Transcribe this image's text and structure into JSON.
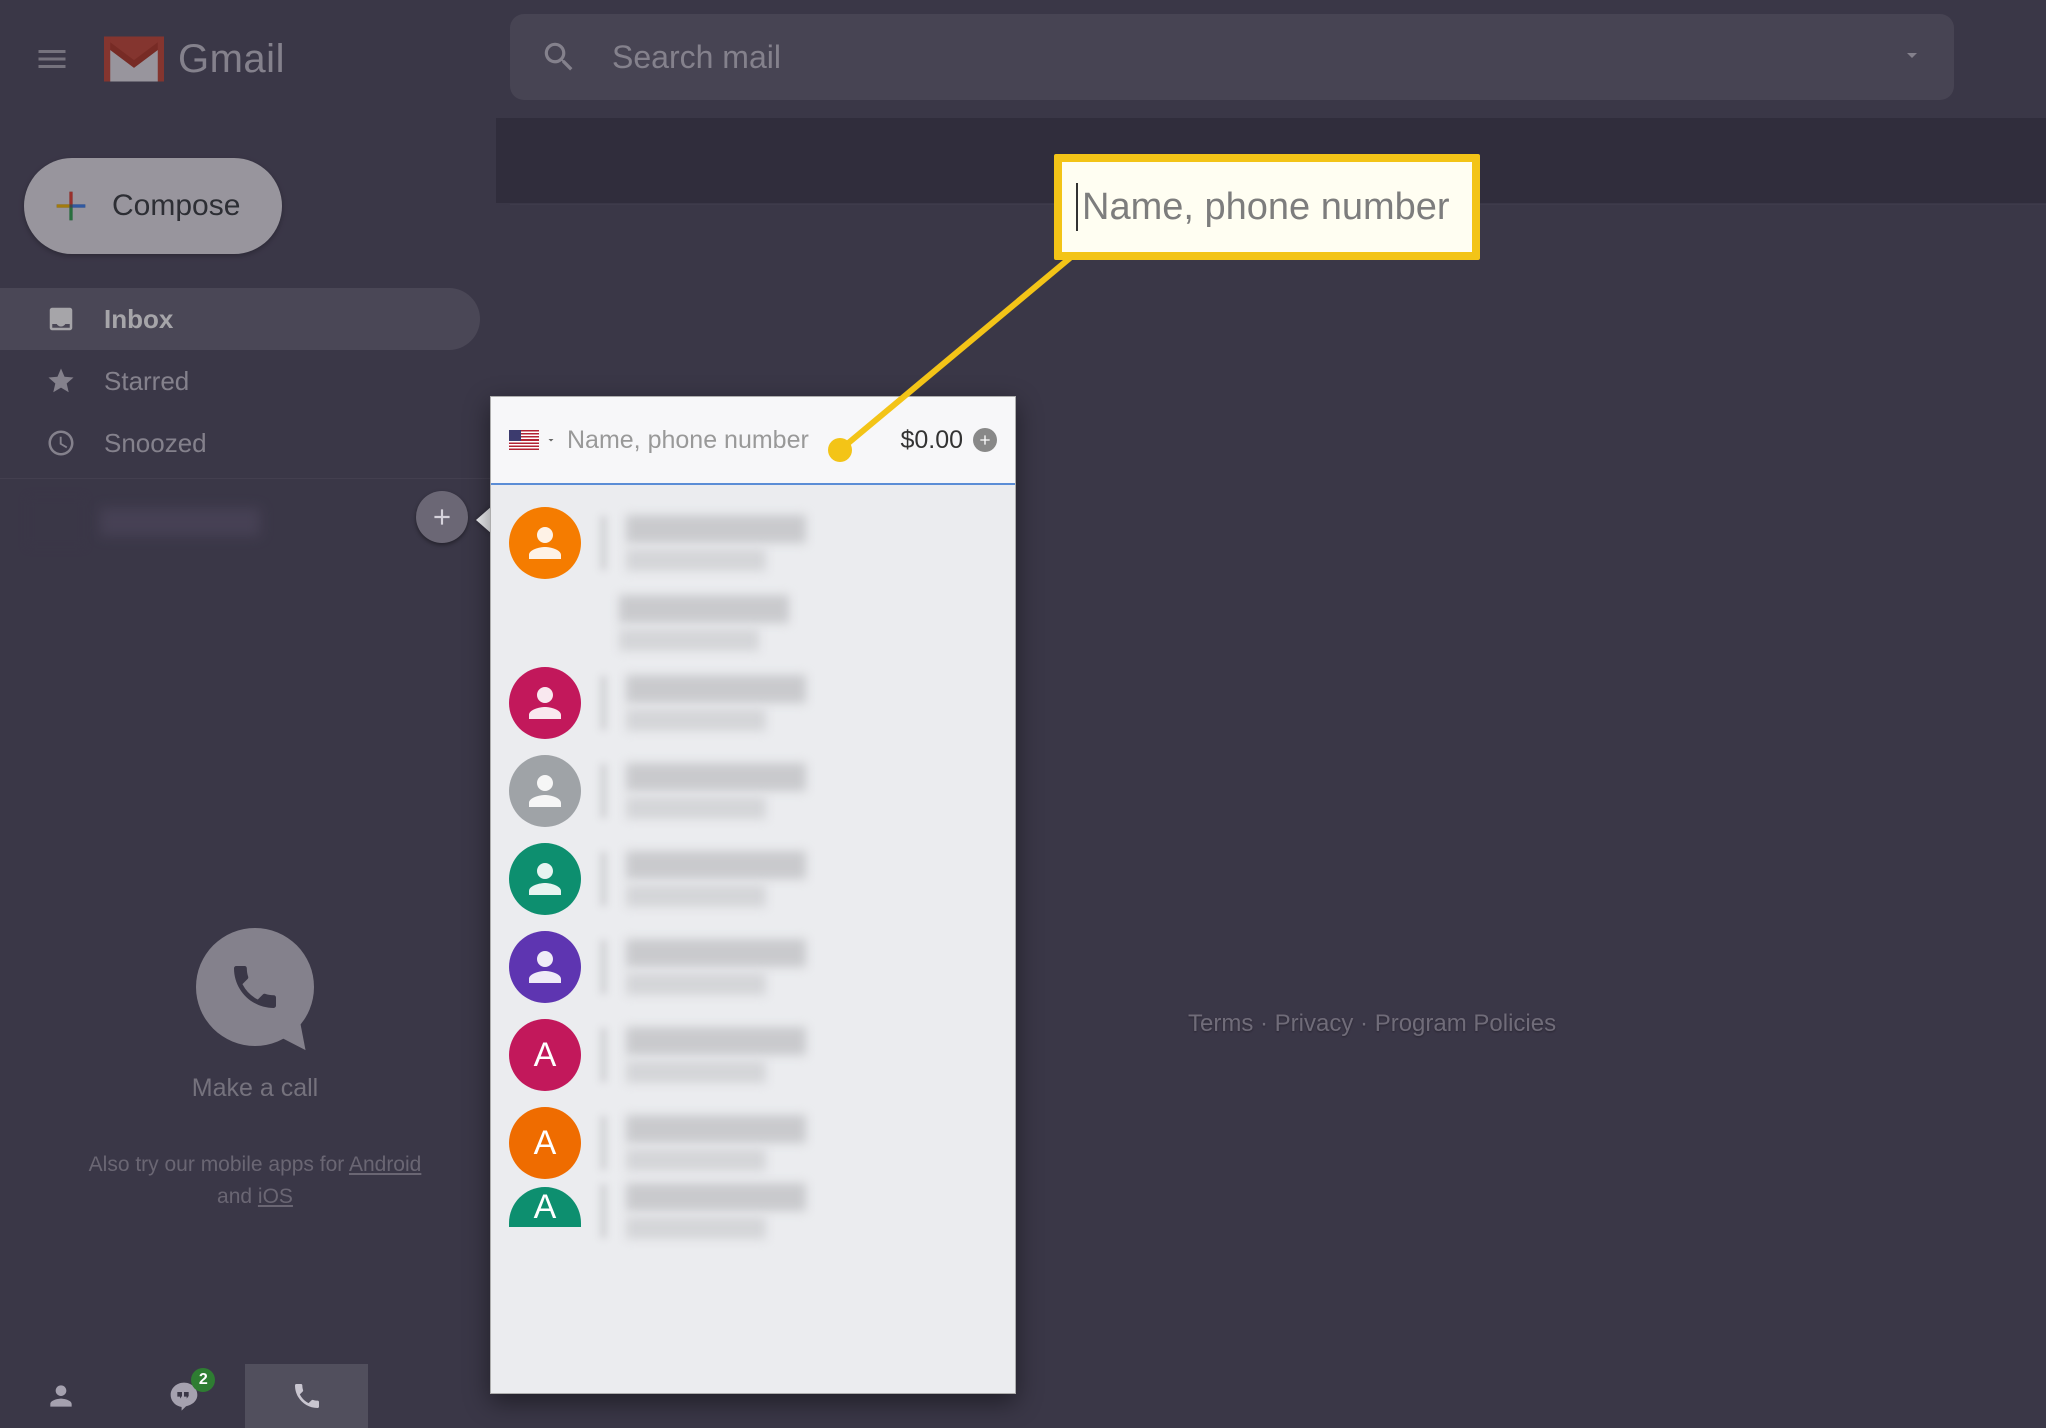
{
  "header": {
    "app_name": "Gmail",
    "search_placeholder": "Search mail"
  },
  "sidebar": {
    "compose_label": "Compose",
    "nav": [
      {
        "label": "Inbox",
        "icon": "inbox",
        "active": true
      },
      {
        "label": "Starred",
        "icon": "star",
        "active": false
      },
      {
        "label": "Snoozed",
        "icon": "clock",
        "active": false
      }
    ],
    "call": {
      "title": "Make a call",
      "subtitle_prefix": "Also try our mobile apps for ",
      "link_android": "Android",
      "subtitle_middle": " and ",
      "link_ios": "iOS"
    }
  },
  "bottom_bar": {
    "hangouts_badge": "2"
  },
  "footer": {
    "terms": "Terms",
    "privacy": "Privacy",
    "policies": "Program Policies",
    "separator": " · "
  },
  "popup": {
    "country": "US",
    "input_placeholder": "Name, phone number",
    "credit": "$0.00",
    "contacts": [
      {
        "avatar_type": "person",
        "color": "#f57c00",
        "extra_line": true
      },
      {
        "avatar_type": "person",
        "color": "#c2185b"
      },
      {
        "avatar_type": "person",
        "color": "#9fa3a7"
      },
      {
        "avatar_type": "person",
        "color": "#0d8f6f"
      },
      {
        "avatar_type": "person",
        "color": "#5e35b1"
      },
      {
        "avatar_type": "letter",
        "letter": "A",
        "color": "#c2185b"
      },
      {
        "avatar_type": "letter",
        "letter": "A",
        "color": "#ef6c00"
      },
      {
        "avatar_type": "letter",
        "letter": "A",
        "color": "#0d8f6f",
        "partial": true
      }
    ]
  },
  "callout": {
    "text": "Name, phone number"
  }
}
